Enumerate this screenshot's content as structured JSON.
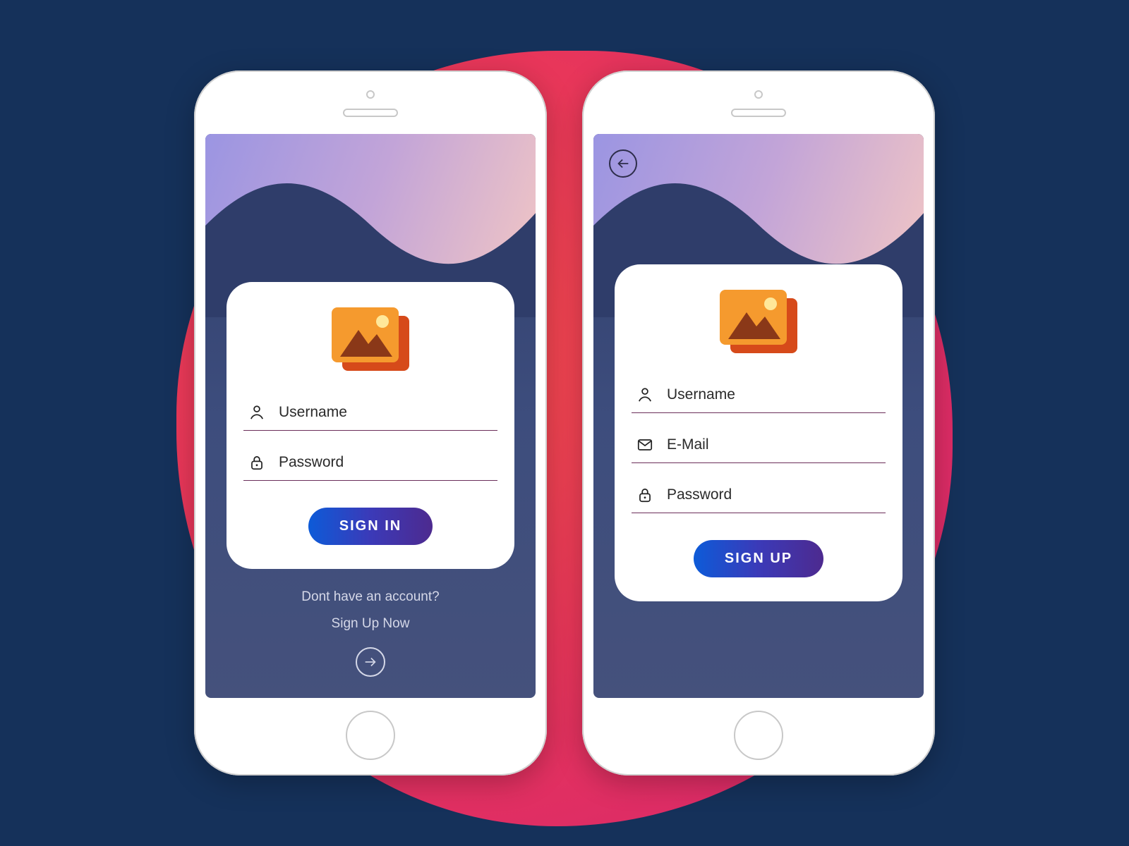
{
  "signin": {
    "fields": {
      "username": "Username",
      "password": "Password"
    },
    "button": "SIGN IN",
    "footer": {
      "line1": "Dont have an account?",
      "line2": "Sign Up Now"
    }
  },
  "signup": {
    "fields": {
      "username": "Username",
      "email": "E-Mail",
      "password": "Password"
    },
    "button": "SIGN UP"
  },
  "icons": {
    "back": "back-arrow-icon",
    "forward": "forward-arrow-icon",
    "user": "user-icon",
    "lock": "lock-icon",
    "mail": "mail-icon",
    "logo": "image-placeholder-icon"
  },
  "colors": {
    "background": "#15315a",
    "blob_gradient": [
      "#f44b4b",
      "#e8365a",
      "#d32370"
    ],
    "button_gradient": [
      "#0d5bd8",
      "#3b3ab8",
      "#4d2a8f"
    ],
    "sky_gradient": [
      "#9b95e2",
      "#c2a4d8",
      "#f0c5c5"
    ]
  }
}
